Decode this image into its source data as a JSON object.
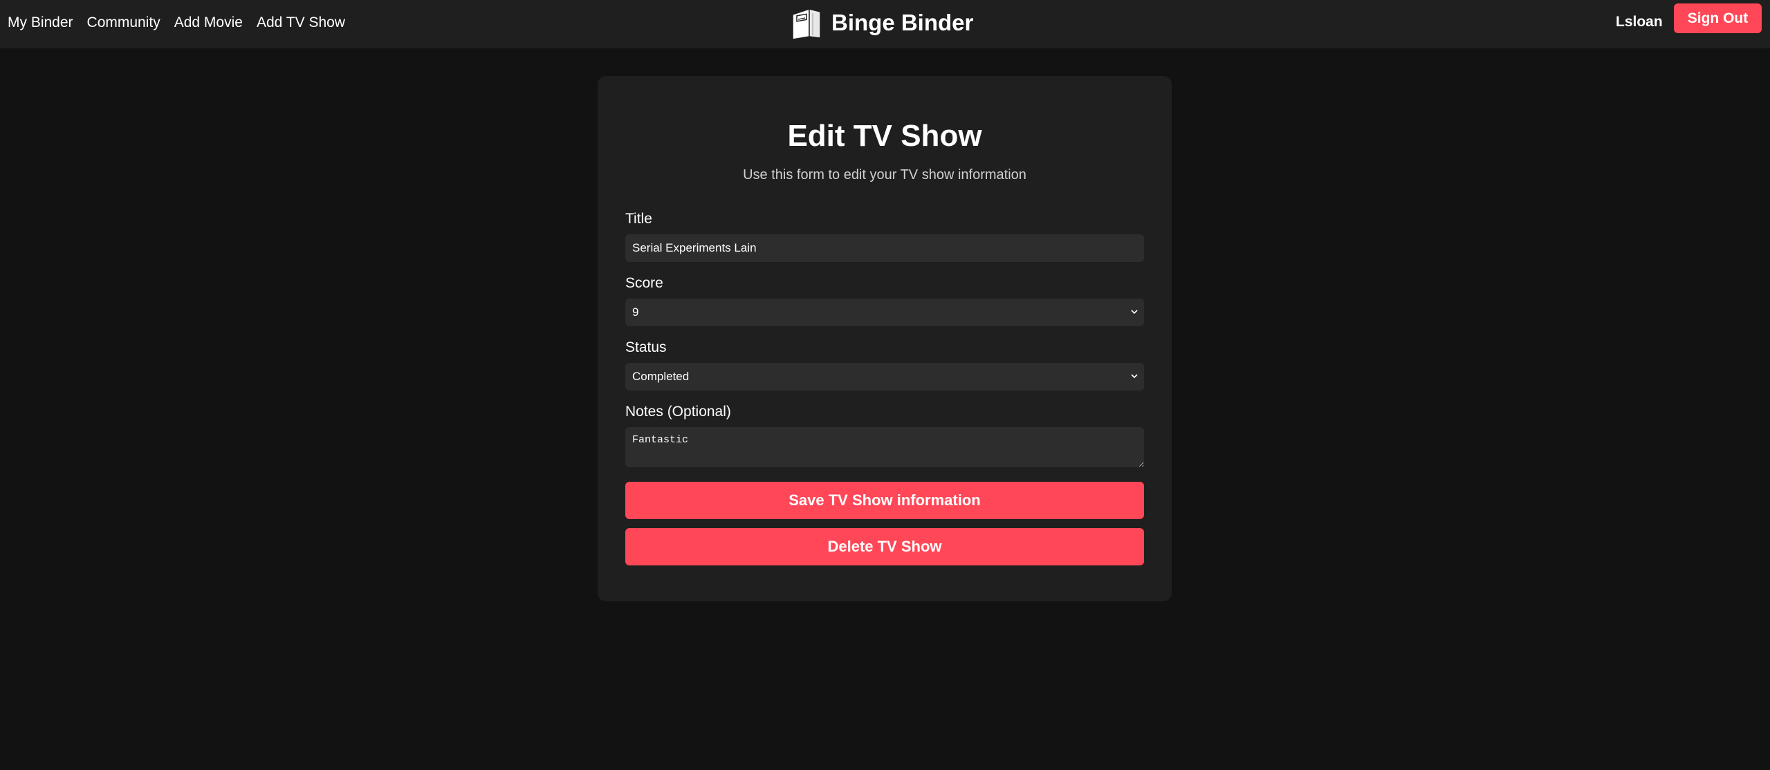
{
  "nav": {
    "links": [
      "My Binder",
      "Community",
      "Add Movie",
      "Add TV Show"
    ],
    "brand_title": "Binge Binder",
    "brand_icon": "binder-icon",
    "user_name": "Lsloan",
    "sign_out_label": "Sign Out"
  },
  "form": {
    "title": "Edit TV Show",
    "subtitle": "Use this form to edit your TV show information",
    "title_label": "Title",
    "title_value": "Serial Experiments Lain",
    "score_label": "Score",
    "score_value": "9",
    "status_label": "Status",
    "status_value": "Completed",
    "notes_label": "Notes (Optional)",
    "notes_value": "Fantastic",
    "save_label": "Save TV Show information",
    "delete_label": "Delete TV Show"
  },
  "colors": {
    "page_bg": "#121212",
    "nav_bg": "#1f1f1f",
    "card_bg": "#1f1f1f",
    "input_bg": "#2d2d2d",
    "accent": "#ff4757"
  }
}
